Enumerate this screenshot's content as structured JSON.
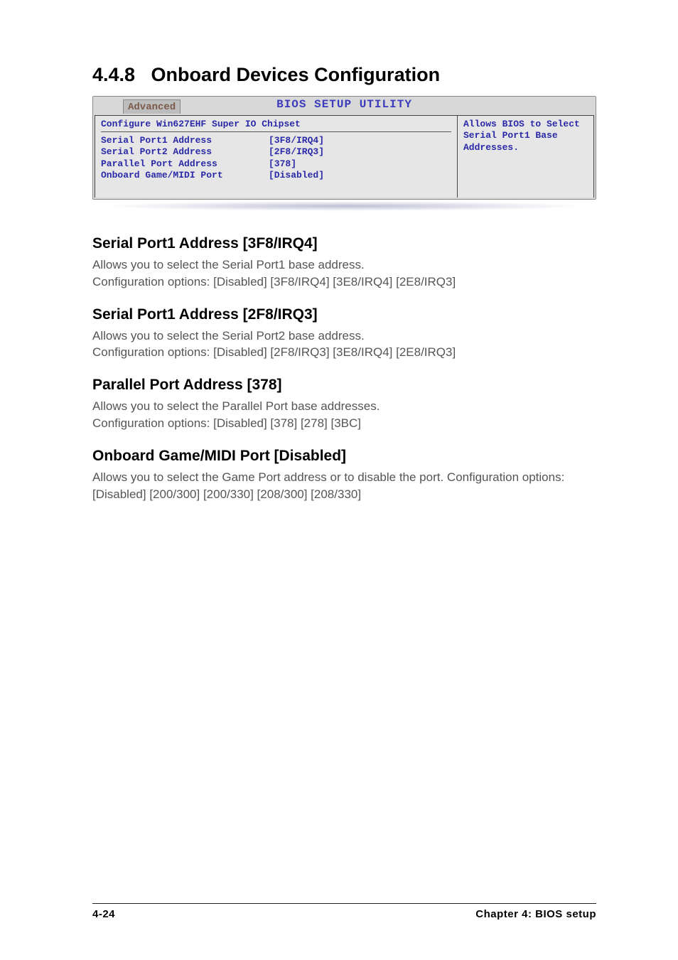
{
  "section": {
    "number": "4.4.8",
    "title": "Onboard Devices Configuration"
  },
  "bios": {
    "banner": "BIOS SETUP UTILITY",
    "tab": "Advanced",
    "config_heading": "Configure Win627EHF Super IO Chipset",
    "rows": [
      {
        "label": "Serial Port1 Address",
        "value": "[3F8/IRQ4]"
      },
      {
        "label": "Serial Port2 Address",
        "value": "[2F8/IRQ3]"
      },
      {
        "label": "Parallel Port Address",
        "value": "[378]"
      },
      {
        "label": "Onboard Game/MIDI Port",
        "value": "[Disabled]"
      }
    ],
    "help": "Allows BIOS to Select Serial Port1 Base Addresses."
  },
  "sections": {
    "sp1": {
      "heading": "Serial Port1 Address [3F8/IRQ4]",
      "body": "Allows you to select the Serial Port1 base address.\nConfiguration options: [Disabled] [3F8/IRQ4] [3E8/IRQ4] [2E8/IRQ3]"
    },
    "sp2": {
      "heading": "Serial Port1 Address [2F8/IRQ3]",
      "body": "Allows you to select the Serial Port2 base address.\nConfiguration options: [Disabled] [2F8/IRQ3] [3E8/IRQ4] [2E8/IRQ3]"
    },
    "pp": {
      "heading": "Parallel Port Address [378]",
      "body": "Allows you to select the Parallel Port base addresses.\nConfiguration options: [Disabled] [378] [278] [3BC]"
    },
    "game": {
      "heading": "Onboard Game/MIDI Port [Disabled]",
      "body": "Allows you to select the Game Port address or to disable the port. Configuration options: [Disabled] [200/300] [200/330] [208/300] [208/330]"
    }
  },
  "footer": {
    "left": "4-24",
    "right": "Chapter 4: BIOS setup"
  }
}
